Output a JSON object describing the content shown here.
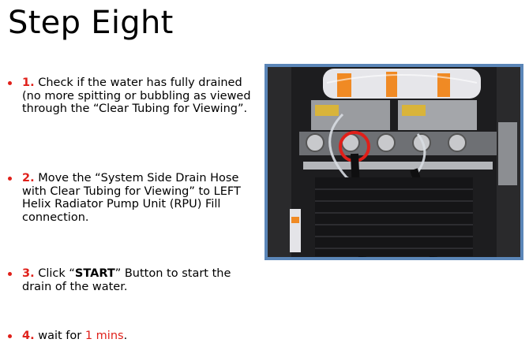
{
  "title": "Step Eight",
  "steps": [
    {
      "number": "1.",
      "text": "Check if the water has fully drained (no more spitting or bubbling as viewed through the “Clear Tubing for Viewing”."
    },
    {
      "number": "2.",
      "text": "Move the “System Side Drain Hose with Clear Tubing for Viewing” to LEFT Helix Radiator Pump Unit (RPU) Fill connection."
    },
    {
      "number": "3.",
      "text_before": "Click “",
      "bold": "START",
      "text_after": "” Button to start the drain of the water."
    },
    {
      "number": "4.",
      "text_before": "wait for ",
      "highlight": "1 mins",
      "text_after": "."
    }
  ],
  "photo": {
    "description_icon": "equipment-photo",
    "frame_color": "#5b86b8",
    "highlight_color": "#e0201a"
  }
}
